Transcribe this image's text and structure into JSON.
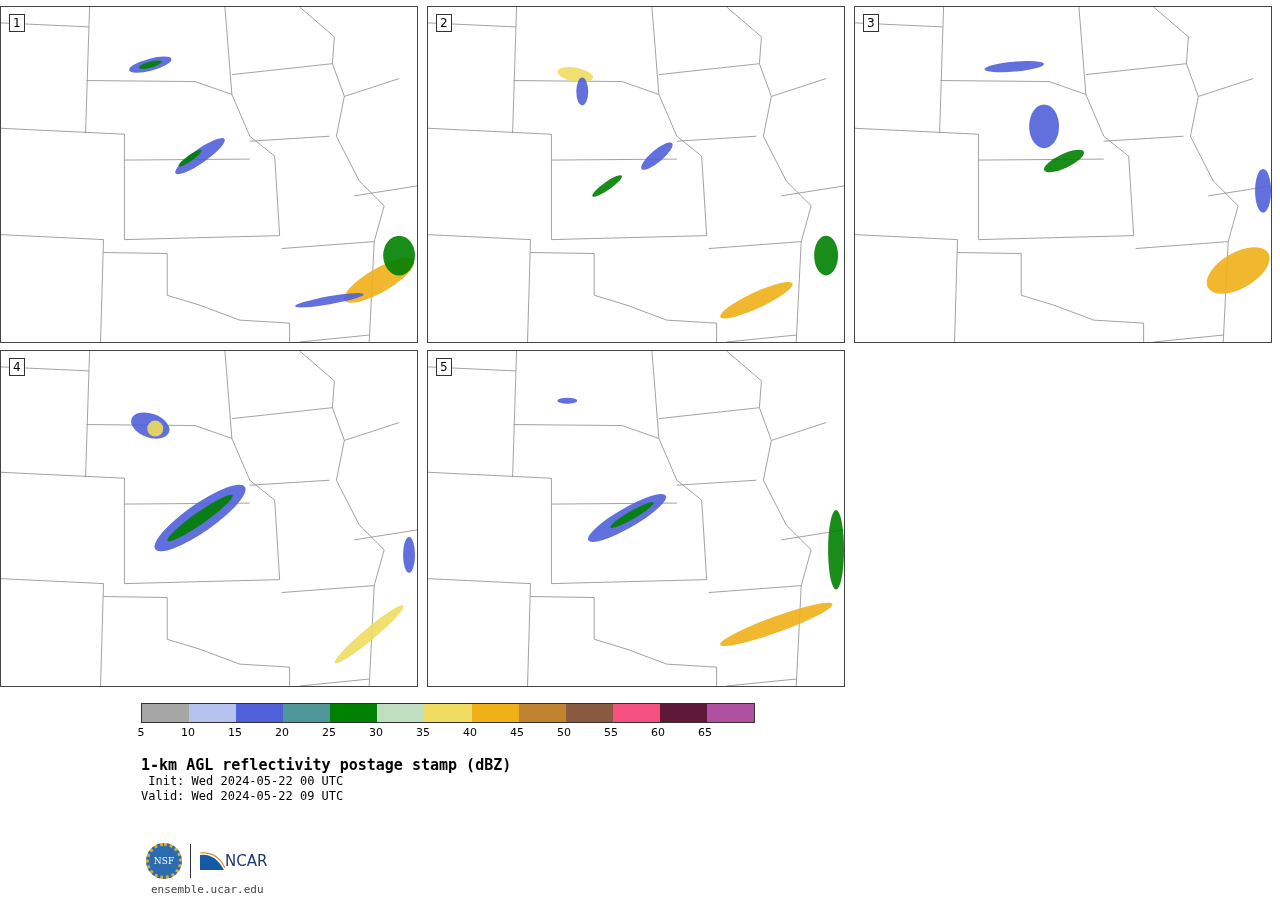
{
  "panels": [
    {
      "label": "1"
    },
    {
      "label": "2"
    },
    {
      "label": "3"
    },
    {
      "label": "4"
    },
    {
      "label": "5"
    }
  ],
  "colorbar": {
    "segments": [
      {
        "color": "#a6a6a6"
      },
      {
        "color": "#b6c2ee"
      },
      {
        "color": "#5060d8"
      },
      {
        "color": "#50979a"
      },
      {
        "color": "#008000"
      },
      {
        "color": "#bfdfc0"
      },
      {
        "color": "#f0dc60"
      },
      {
        "color": "#f0b018"
      },
      {
        "color": "#c08430"
      },
      {
        "color": "#8a5a40"
      },
      {
        "color": "#f55080"
      },
      {
        "color": "#601838"
      },
      {
        "color": "#b050a0"
      }
    ],
    "ticks": [
      "5",
      "10",
      "15",
      "20",
      "25",
      "30",
      "35",
      "40",
      "45",
      "50",
      "55",
      "60",
      "65"
    ]
  },
  "title": "1-km AGL reflectivity postage stamp (dBZ)",
  "init": "Init: Wed 2024-05-22 00 UTC",
  "valid": "Valid: Wed 2024-05-22 09 UTC",
  "logo": {
    "nsf": "NSF",
    "ncar": "NCAR"
  },
  "site": "ensemble.ucar.edu"
}
